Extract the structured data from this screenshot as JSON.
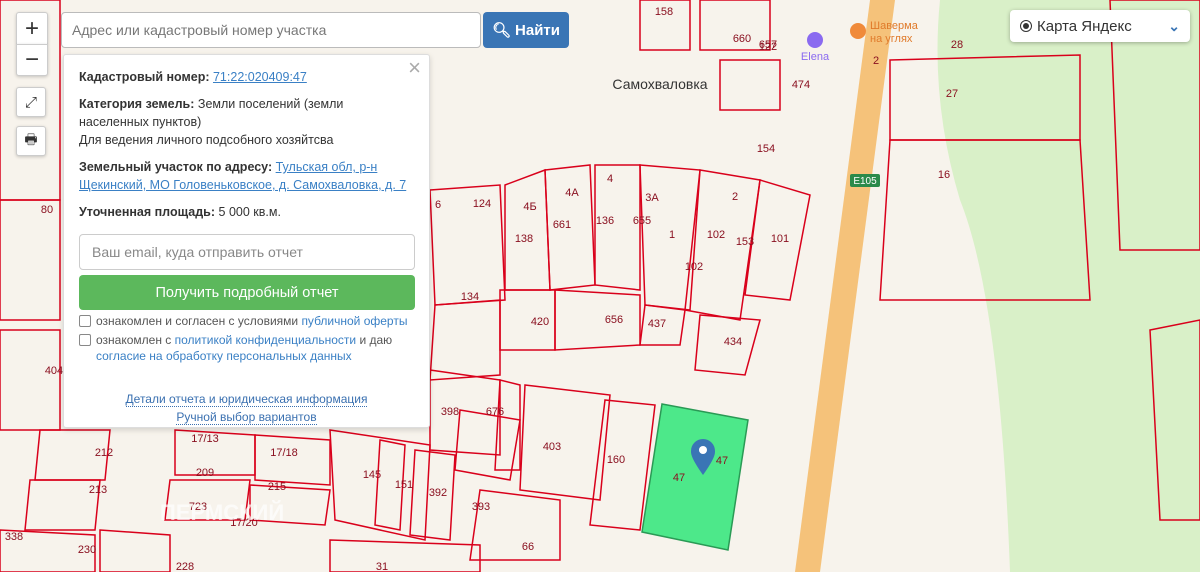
{
  "search": {
    "placeholder": "Адрес или кадастровый номер участка",
    "button": "Найти"
  },
  "controls": {
    "zoom_in": "+",
    "zoom_out": "−"
  },
  "layer": {
    "selected": "Карта Яндекс"
  },
  "popup": {
    "cadastral_label": "Кадастровый номер:",
    "cadastral_value": "71:22:020409:47",
    "category_label": "Категория земель:",
    "category_value": "Земли поселений (земли населенных пунктов)",
    "usage": "Для ведения личного подсобного хозяйтсва",
    "address_label": "Земельный участок по адресу:",
    "address_value": "Тульская обл, р-н Щекинский, МО Головеньковское, д. Самохваловка, д. 7",
    "area_label": "Уточненная площадь:",
    "area_value": "5 000 кв.м.",
    "email_placeholder": "Ваш email, куда отправить отчет",
    "report_button": "Получить подробный отчет",
    "consent1_text": "ознакомлен и согласен с условиями ",
    "consent1_link": "публичной оферты",
    "consent2_text": "ознакомлен с ",
    "consent2_link": "политикой конфиденциальности",
    "consent2_mid": " и даю ",
    "consent2_link2": "согласие на обработку персональных данных",
    "details_link": "Детали отчета и юридическая информация",
    "manual_link": "Ручной выбор вариантов"
  },
  "map": {
    "village": "Самохваловка",
    "road": "E105",
    "poi": [
      "Шаверма",
      "на углях",
      "Elena"
    ],
    "watermark": "ПЕРМСКИЙ",
    "labels": [
      "154",
      "474",
      "660",
      "657",
      "122",
      "158",
      "28",
      "27",
      "16",
      "2",
      "124",
      "6",
      "4Б",
      "4А",
      "4",
      "3А",
      "2",
      "138",
      "661",
      "136",
      "655",
      "1",
      "102",
      "153",
      "101",
      "134",
      "420",
      "656",
      "437",
      "434",
      "398",
      "676",
      "403",
      "160",
      "47",
      "47",
      "212",
      "209",
      "213",
      "215",
      "145",
      "151",
      "392",
      "393",
      "66",
      "338",
      "230",
      "228",
      "31",
      "80",
      "404",
      "17/13",
      "17/18",
      "17/20",
      "723",
      "102"
    ],
    "selected_parcel_color": "#4de88a",
    "parcel_border_color": "#d9001b",
    "road_color": "#f5c27a"
  }
}
